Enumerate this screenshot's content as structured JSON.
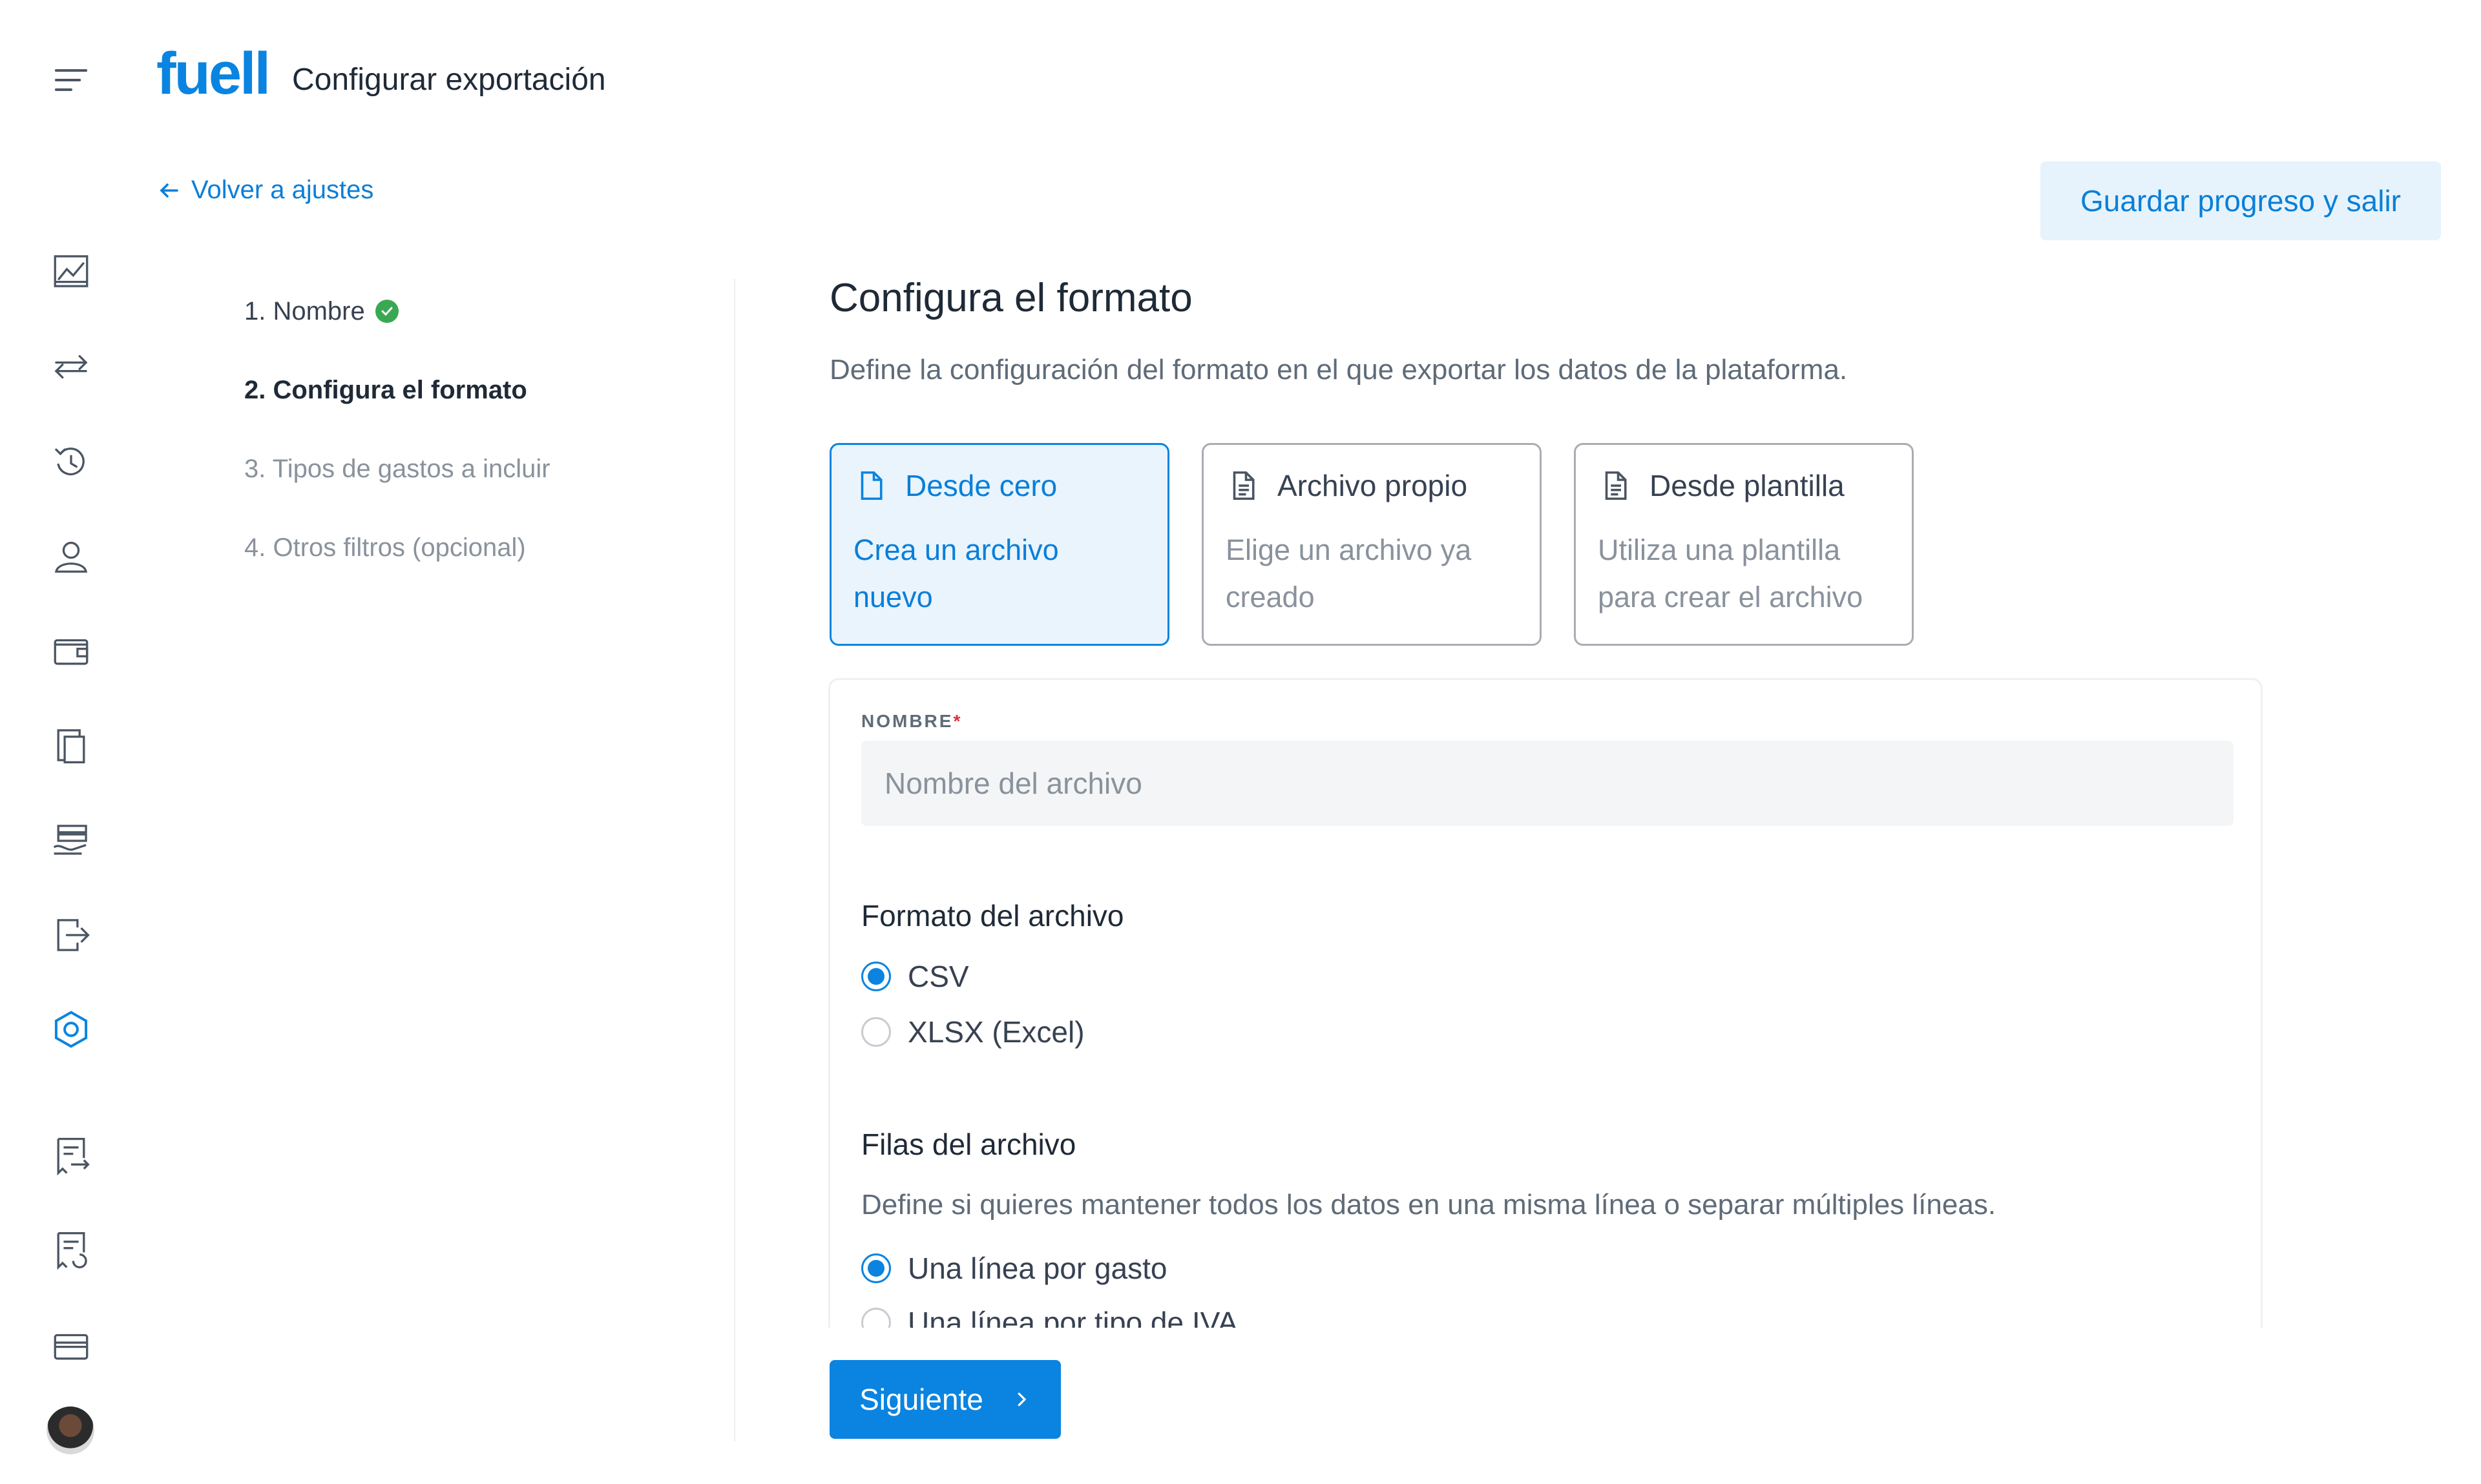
{
  "header": {
    "logo": "fuell",
    "title": "Configurar exportación"
  },
  "nav": {
    "back_label": "Volver a ajustes",
    "save_exit_label": "Guardar progreso y salir"
  },
  "steps": [
    {
      "label": "1. Nombre",
      "state": "done"
    },
    {
      "label": "2. Configura el formato",
      "state": "active"
    },
    {
      "label": "3. Tipos de gastos a incluir",
      "state": "pending"
    },
    {
      "label": "4. Otros filtros (opcional)",
      "state": "pending"
    }
  ],
  "main": {
    "title": "Configura el formato",
    "description": "Define la configuración del formato en el que exportar los datos de la plataforma.",
    "source_cards": [
      {
        "title": "Desde cero",
        "body": "Crea un archivo nuevo",
        "selected": true
      },
      {
        "title": "Archivo propio",
        "body": "Elige un archivo ya creado",
        "selected": false
      },
      {
        "title": "Desde plantilla",
        "body": "Utiliza una plantilla para crear el archivo",
        "selected": false
      }
    ],
    "name_field": {
      "label": "NOMBRE",
      "required_mark": "*",
      "placeholder": "Nombre del archivo",
      "value": ""
    },
    "format": {
      "title": "Formato del archivo",
      "options": [
        {
          "label": "CSV",
          "checked": true
        },
        {
          "label": "XLSX (Excel)",
          "checked": false
        }
      ]
    },
    "rows": {
      "title": "Filas del archivo",
      "description": "Define si quieres mantener todos los datos en una misma línea o separar múltiples líneas.",
      "options": [
        {
          "label": "Una línea por gasto",
          "checked": true
        },
        {
          "label": "Una línea por tipo de IVA",
          "checked": false
        }
      ]
    },
    "next_label": "Siguiente"
  },
  "colors": {
    "accent": "#0a84e0",
    "success": "#3aa853",
    "muted": "#8a929c"
  }
}
